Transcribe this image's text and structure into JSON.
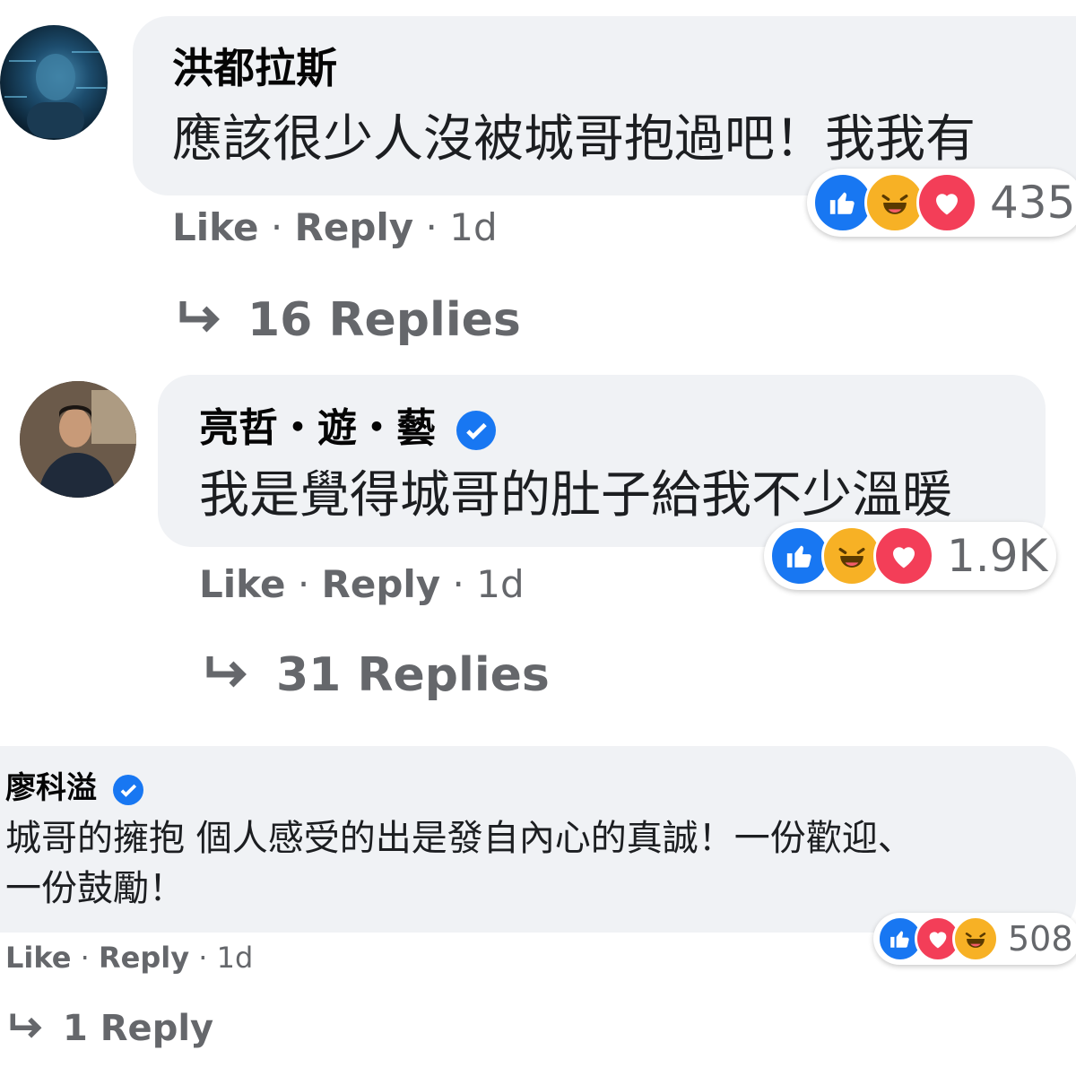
{
  "comments": [
    {
      "author": "洪都拉斯",
      "text": "應該很少人沒被城哥抱過吧！我我有",
      "verified": false,
      "actions": {
        "like": "Like",
        "reply": "Reply",
        "time": "1d",
        "sep": "·"
      },
      "reactions": {
        "types": [
          "like-icon",
          "haha-icon",
          "love-icon"
        ],
        "count": "435"
      },
      "replies_label": "16 Replies"
    },
    {
      "author": "亮哲・遊・藝",
      "text": "我是覺得城哥的肚子給我不少溫暖",
      "verified": true,
      "actions": {
        "like": "Like",
        "reply": "Reply",
        "time": "1d",
        "sep": "·"
      },
      "reactions": {
        "types": [
          "like-icon",
          "haha-icon",
          "love-icon"
        ],
        "count": "1.9K"
      },
      "replies_label": "31 Replies"
    },
    {
      "author": "廖科溢",
      "text_line1": "城哥的擁抱 個人感受的出是發自內心的真誠！一份歡迎、",
      "text_line2": "一份鼓勵！",
      "verified": true,
      "actions": {
        "like": "Like",
        "reply": "Reply",
        "time": "1d",
        "sep": "·"
      },
      "reactions": {
        "types": [
          "like-icon",
          "love-icon",
          "haha-icon"
        ],
        "count": "508"
      },
      "replies_label": "1 Reply"
    }
  ],
  "colors": {
    "bubble": "#f0f2f5",
    "secondary_text": "#65676b",
    "like_blue": "#1877f2",
    "haha_yellow": "#f7b125",
    "love_red": "#f33e58"
  }
}
